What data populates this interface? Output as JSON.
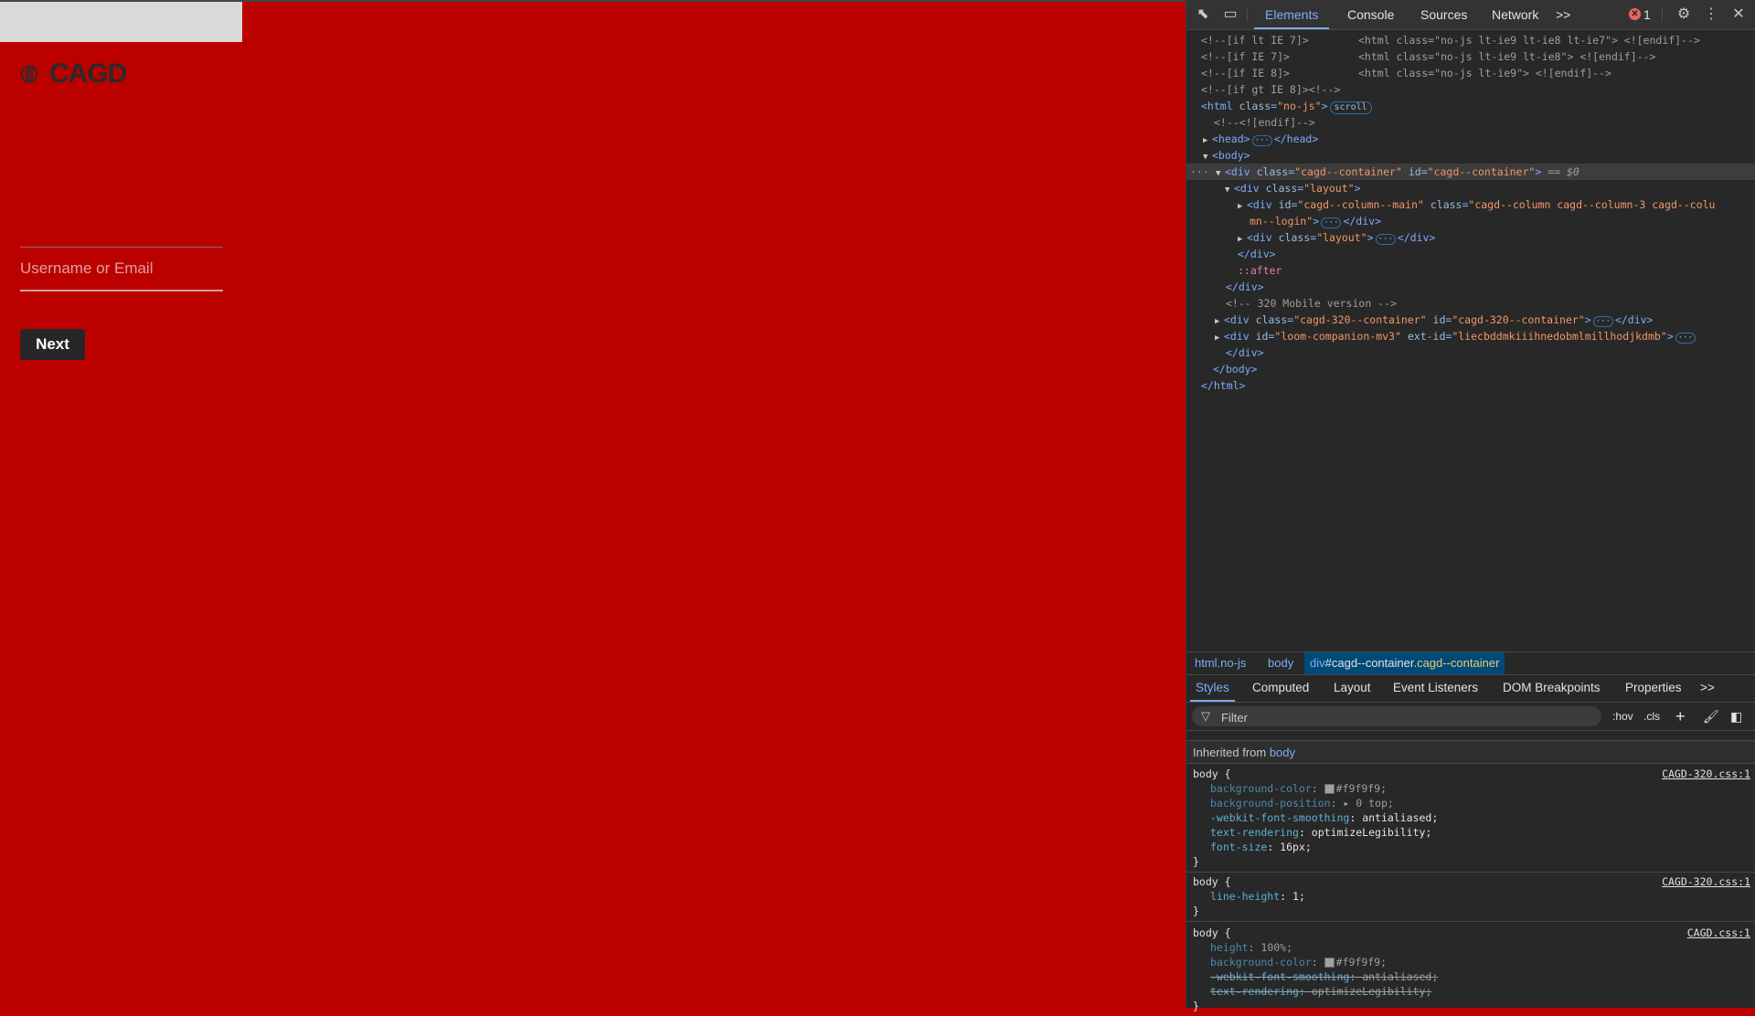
{
  "page": {
    "logo_text": "CAGD",
    "username_placeholder": "Username or Email",
    "username_value": "",
    "next_label": "Next",
    "colors": {
      "background": "#bb0000",
      "button": "#262626",
      "logo": "#2a2a2a"
    }
  },
  "devtools": {
    "tabs": [
      "Elements",
      "Console",
      "Sources",
      "Network"
    ],
    "active_tab": "Elements",
    "more_tabs": ">>",
    "error_count": "1",
    "tree": [
      {
        "c1": "<!--[if lt IE 7]>",
        "c2": "<html class=\"no-js lt-ie9 lt-ie8 lt-ie7\"> <![endif]-->"
      },
      {
        "c1": "<!--[if IE 7]>",
        "c2": "<html class=\"no-js lt-ie9 lt-ie8\"> <![endif]-->"
      },
      {
        "c1": "<!--[if IE 8]>",
        "c2": "<html class=\"no-js lt-ie9\"> <![endif]-->"
      },
      {
        "c1": "<!--[if gt IE 8]><!-->"
      }
    ],
    "html_tag": {
      "open": "<html ",
      "attr": "class",
      "value": "\"no-js\"",
      "close": ">",
      "badge": "scroll"
    },
    "endif_comment": "<!--<![endif]-->",
    "head": {
      "open": "<head>",
      "close": "</head>"
    },
    "body_open": "<body>",
    "container": {
      "open": "<div ",
      "attr1": "class",
      "val1": "\"cagd--container\"",
      "attr2": "id",
      "val2": "\"cagd--container\"",
      "close": ">",
      "marker": "== $0"
    },
    "layout_open": {
      "open": "<div ",
      "attr": "class",
      "val": "\"layout\"",
      "close": ">"
    },
    "column_main": {
      "open": "<div ",
      "attr1": "id",
      "val1": "\"cagd--column--main\"",
      "attr2": "class",
      "val2a": "\"cagd--column cagd--column-3 cagd--colu",
      "val2b": "mn--login\"",
      "close": ">",
      "end": "</div>"
    },
    "layout_inner": {
      "open": "<div ",
      "attr": "class",
      "val": "\"layout\"",
      "close": ">",
      "end": "</div>"
    },
    "div_close": "</div>",
    "after_pseudo": "::after",
    "div_close2": "</div>",
    "mobile_comment": "<!-- 320 Mobile version -->",
    "mobile_container": {
      "open": "<div ",
      "attr1": "class",
      "val1": "\"cagd-320--container\"",
      "attr2": "id",
      "val2": "\"cagd-320--container\"",
      "close": ">",
      "end": "</div>"
    },
    "loom": {
      "open": "<div ",
      "attr1": "id",
      "val1": "\"loom-companion-mv3\"",
      "attr2": "ext-id",
      "val2": "\"liecbddmkiiihnedobmlmillhodjkdmb\"",
      "close": ">"
    },
    "div_close3": "</div>",
    "body_close": "</body>",
    "html_close": "</html>",
    "breadcrumbs": {
      "items": [
        "html.no-js",
        "body"
      ],
      "active": {
        "tag": "div",
        "id": "#cagd--container",
        "cls": ".cagd--container"
      }
    },
    "style_tabs": [
      "Styles",
      "Computed",
      "Layout",
      "Event Listeners",
      "DOM Breakpoints",
      "Properties"
    ],
    "style_more": ">>",
    "filter_placeholder": "Filter",
    "hov": ":hov",
    "cls": ".cls",
    "inherited_label": "Inherited from",
    "inherited_tag": "body",
    "rules": [
      {
        "selector": "body {",
        "source": "CAGD-320.css:1",
        "props": [
          {
            "name": "background-color",
            "value": "#f9f9f9;",
            "swatch": true,
            "dim": true
          },
          {
            "name": "background-position",
            "value": "▸ 0 top;",
            "dim": true
          },
          {
            "name": "-webkit-font-smoothing",
            "value": "antialiased;"
          },
          {
            "name": "text-rendering",
            "value": "optimizeLegibility;"
          },
          {
            "name": "font-size",
            "value": "16px;"
          }
        ]
      },
      {
        "selector": "body {",
        "source": "CAGD-320.css:1",
        "props": [
          {
            "name": "line-height",
            "value": "1;"
          }
        ]
      },
      {
        "selector": "body {",
        "source": "CAGD.css:1",
        "props": [
          {
            "name": "height",
            "value": "100%;",
            "dim": true
          },
          {
            "name": "background-color",
            "value": "#f9f9f9;",
            "swatch": true,
            "dim": true
          },
          {
            "name": "-webkit-font-smoothing",
            "value": "antialiased;",
            "strike": true
          },
          {
            "name": "text-rendering",
            "value": "optimizeLegibility;",
            "strike": true
          }
        ]
      }
    ],
    "close_brace": "}"
  }
}
